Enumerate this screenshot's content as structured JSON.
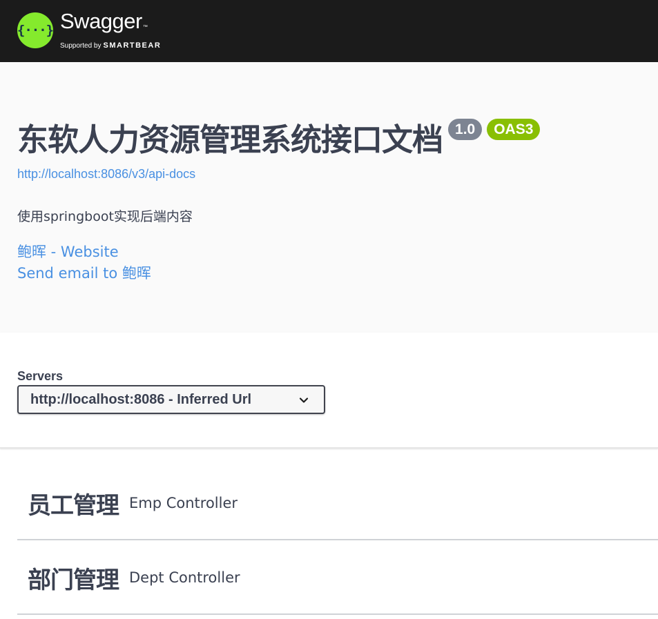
{
  "topbar": {
    "logo_symbol": "{···}",
    "logo_name": "Swagger",
    "logo_tm": "™",
    "logo_supported": "Supported by",
    "logo_brand": "SMARTBEAR",
    "background_color": "#1b1b1b",
    "accent_color": "#85ea2d"
  },
  "info": {
    "title": "东软人力资源管理系统接口文档",
    "version": "1.0",
    "oas_badge": "OAS3",
    "spec_url": "http://localhost:8086/v3/api-docs",
    "description": "使用springboot实现后端内容",
    "contact_website": "鲍晖 - Website",
    "contact_email": "Send email to 鲍晖"
  },
  "servers": {
    "label": "Servers",
    "selected": "http://localhost:8086 - Inferred Url",
    "icon": "chevron-down-icon"
  },
  "tags": [
    {
      "name": "员工管理",
      "description": "Emp Controller"
    },
    {
      "name": "部门管理",
      "description": "Dept Controller"
    }
  ],
  "colors": {
    "link": "#4990e2",
    "version_badge": "#7d8492",
    "oas_badge": "#89bf04",
    "text": "#3b4151"
  }
}
